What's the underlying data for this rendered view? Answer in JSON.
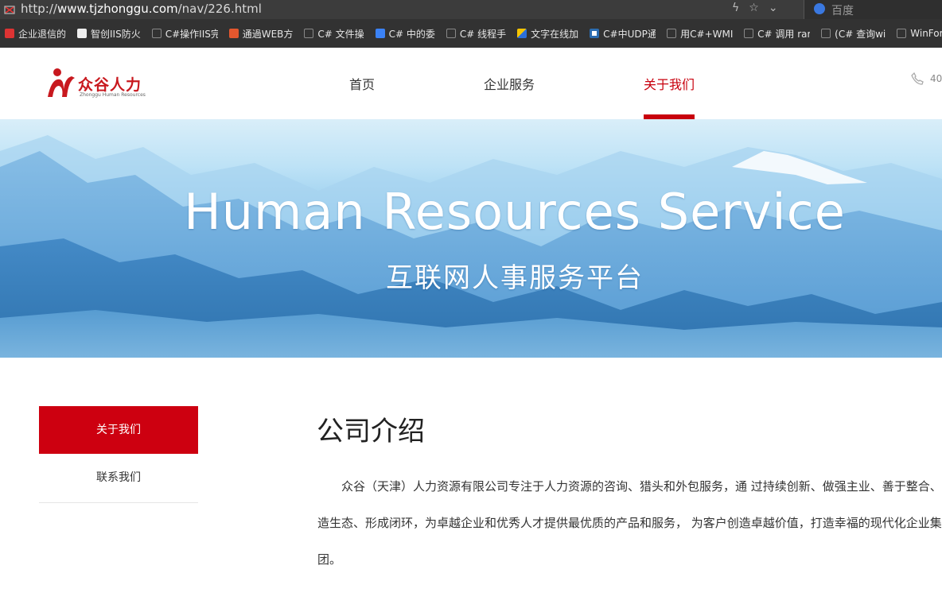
{
  "browser": {
    "url_prefix": "http://",
    "url_domain": "www.tjzhonggu.com",
    "url_path": "/nav/226.html",
    "search_placeholder": "百度"
  },
  "bookmarks": [
    {
      "label": "企业退信的",
      "icon": "red"
    },
    {
      "label": "智创IIS防火",
      "icon": "doc"
    },
    {
      "label": "C#操作IIS完",
      "icon": "ring"
    },
    {
      "label": "通過WEB方",
      "icon": "orange"
    },
    {
      "label": "C# 文件操",
      "icon": "ring"
    },
    {
      "label": "C# 中的委",
      "icon": "blue"
    },
    {
      "label": "C# 线程手",
      "icon": "ring"
    },
    {
      "label": "文字在线加",
      "icon": "yb"
    },
    {
      "label": "C#中UDP通",
      "icon": "circ"
    },
    {
      "label": "用C#+WMI",
      "icon": "ring"
    },
    {
      "label": "C# 调用 rar",
      "icon": "ring"
    },
    {
      "label": "(C# 查询wi",
      "icon": "ring"
    },
    {
      "label": "WinForm",
      "icon": "ring"
    }
  ],
  "site": {
    "logo_cn": "众谷人力",
    "logo_en": "Zhonggu Human Resources",
    "nav": [
      {
        "label": "首页",
        "active": false
      },
      {
        "label": "企业服务",
        "active": false
      },
      {
        "label": "关于我们",
        "active": true
      }
    ],
    "phone": "40",
    "accent_color": "#c8000d"
  },
  "banner": {
    "title_en": "Human Resources Service",
    "title_cn": "互联网人事服务平台"
  },
  "sidebar": {
    "items": [
      {
        "label": "关于我们",
        "active": true
      },
      {
        "label": "联系我们",
        "active": false
      }
    ]
  },
  "content": {
    "heading": "公司介绍",
    "paragraph": "众谷（天津）人力资源有限公司专注于人力资源的咨询、猎头和外包服务，通 过持续创新、做强主业、善于整合、打造生态、形成闭环，为卓越企业和优秀人才提供最优质的产品和服务， 为客户创造卓越价值，打造幸福的现代化企业集团。"
  }
}
